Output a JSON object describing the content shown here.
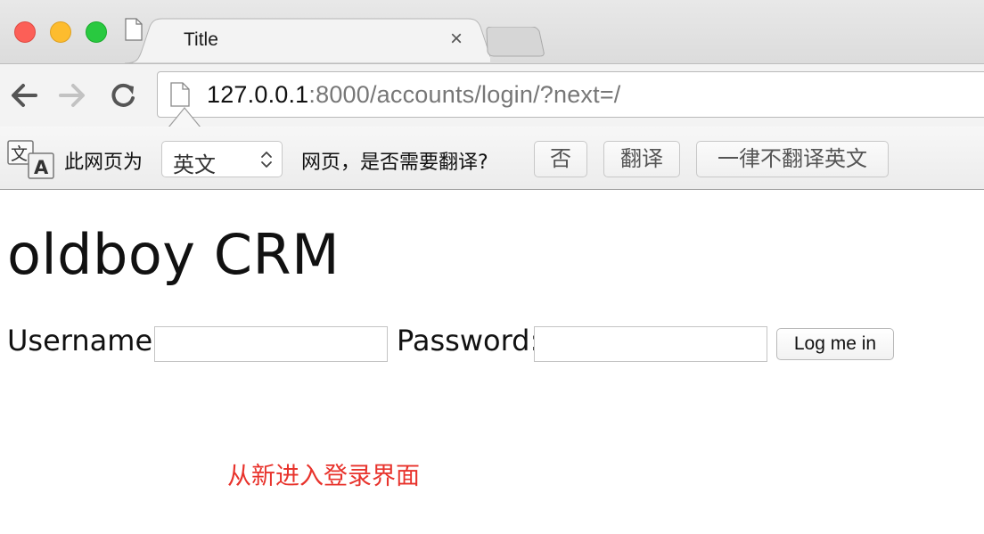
{
  "browser": {
    "tab": {
      "title": "Title",
      "close_symbol": "×",
      "icon": "page-icon"
    },
    "address_bar": {
      "url_host": "127.0.0.1",
      "url_path": ":8000/accounts/login/?next=/"
    },
    "translate_bar": {
      "label_prefix": "此网页为",
      "language_selected": "英文",
      "label_suffix": "网页，是否需要翻译?",
      "no_button": "否",
      "translate_button": "翻译",
      "never_button": "一律不翻译英文"
    }
  },
  "page": {
    "title": "oldboy CRM",
    "form": {
      "username_label": "Username:",
      "username_value": "",
      "password_label": "Password:",
      "password_value": "",
      "submit_label": "Log me in"
    },
    "annotation": "从新进入登录界面"
  },
  "colors": {
    "annotation": "#e8332c",
    "traffic_close": "#fc5f57",
    "traffic_minimize": "#fdbc2e",
    "traffic_maximize": "#29c940"
  }
}
